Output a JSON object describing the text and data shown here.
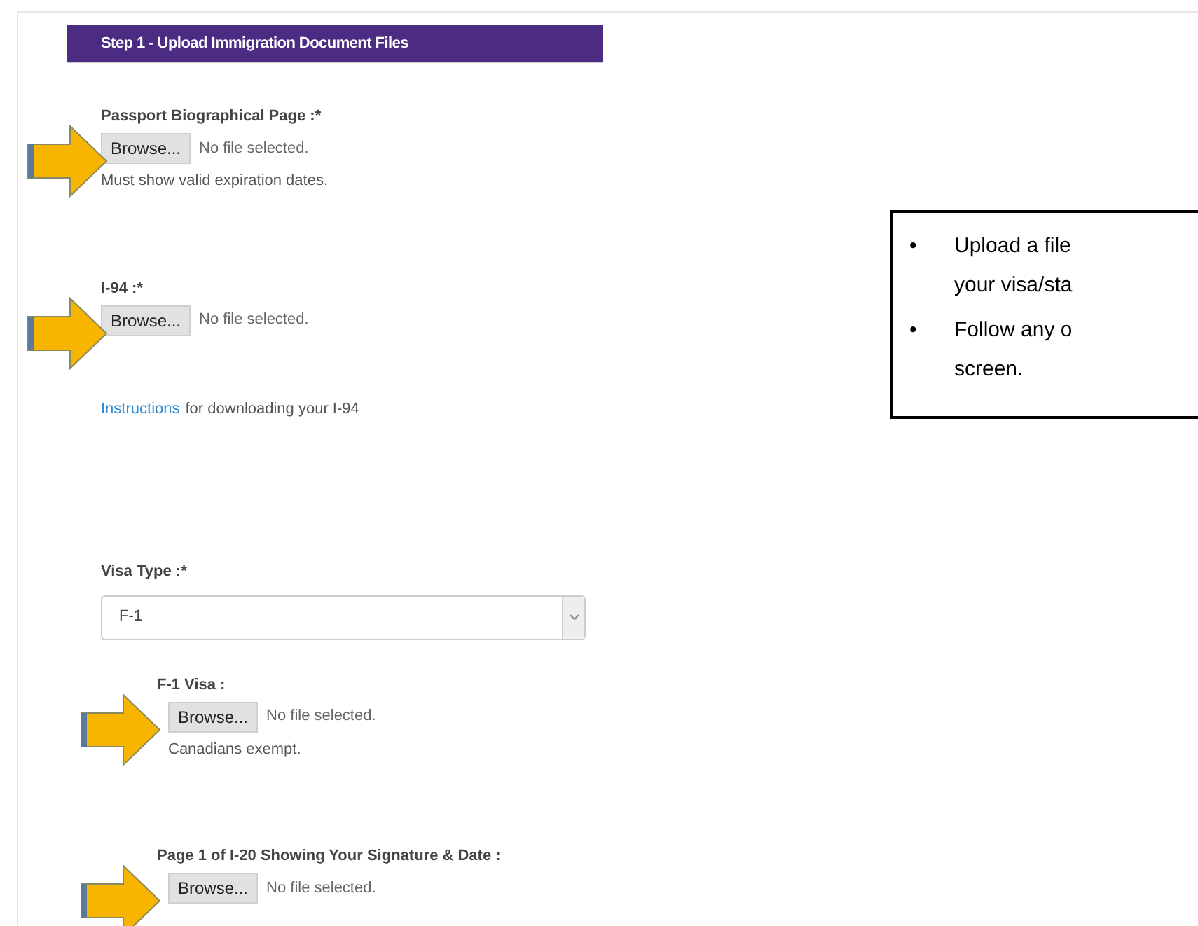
{
  "header": {
    "title": "Step 1 - Upload Immigration Document Files"
  },
  "fields": [
    {
      "kind": "file",
      "label": "Passport Biographical Page :*",
      "button": "Browse...",
      "status": "No file selected.",
      "note": "Must show valid expiration dates.",
      "indented": false,
      "arrow": true
    },
    {
      "kind": "file",
      "label": "I-94 :*",
      "button": "Browse...",
      "status": "No file selected.",
      "indented": false,
      "arrow": true
    },
    {
      "kind": "link-note",
      "link": "Instructions",
      "text": "for downloading your I-94"
    },
    {
      "kind": "select",
      "label": "Visa Type :*",
      "value": "F-1"
    },
    {
      "kind": "file",
      "label": "F-1 Visa :",
      "button": "Browse...",
      "status": "No file selected.",
      "note": "Canadians exempt.",
      "indented": true,
      "arrow": true
    },
    {
      "kind": "file",
      "label": "Page 1 of I-20 Showing Your Signature & Date :",
      "button": "Browse...",
      "status": "No file selected.",
      "indented": true,
      "arrow": true
    }
  ],
  "callout": {
    "bullets": [
      {
        "marker": "•",
        "lines": [
          "Upload a file",
          "your visa/sta"
        ]
      },
      {
        "marker": "•",
        "lines": [
          "Follow any o",
          "screen."
        ]
      }
    ]
  }
}
